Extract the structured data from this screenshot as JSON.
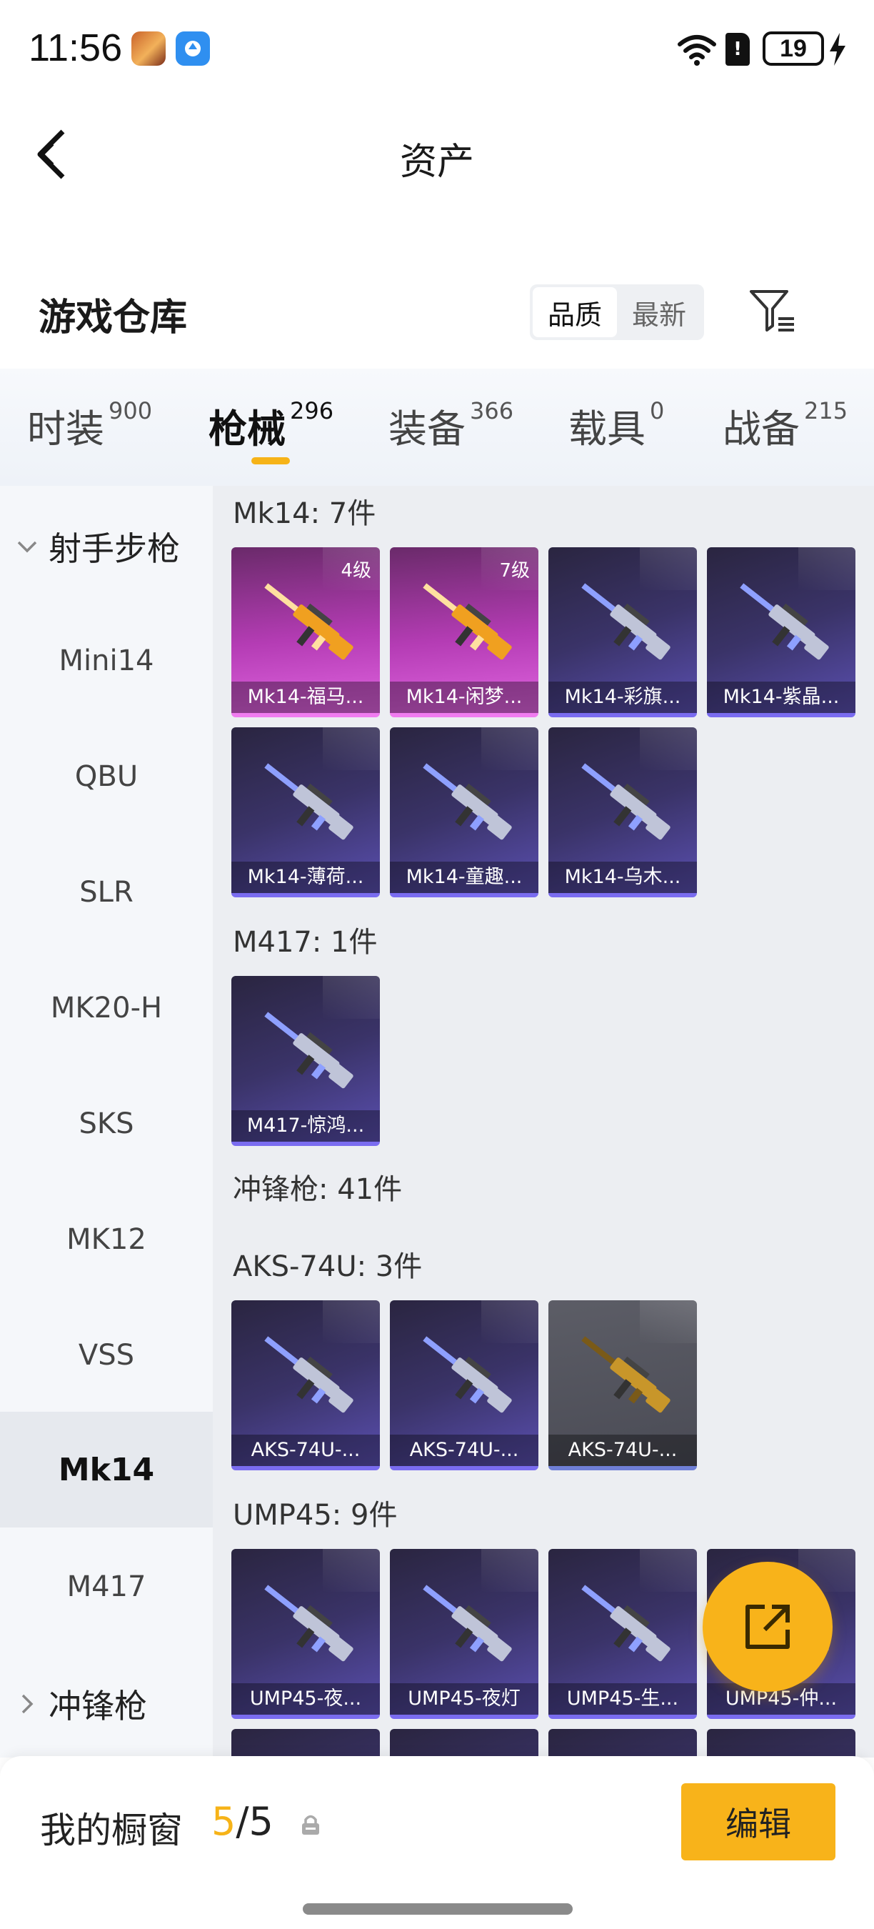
{
  "status_bar": {
    "time": "11:56",
    "battery": "19"
  },
  "header": {
    "title": "资产"
  },
  "warehouse": {
    "title": "游戏仓库",
    "sort_options": [
      "品质",
      "最新"
    ],
    "active_sort": "品质"
  },
  "tabs": [
    {
      "label": "时装",
      "count": "900"
    },
    {
      "label": "枪械",
      "count": "296"
    },
    {
      "label": "装备",
      "count": "366"
    },
    {
      "label": "载具",
      "count": "0"
    },
    {
      "label": "战备",
      "count": "215"
    }
  ],
  "active_tab": "枪械",
  "sidebar": {
    "group_expanded": "射手步枪",
    "items": [
      "Mini14",
      "QBU",
      "SLR",
      "MK20-H",
      "SKS",
      "MK12",
      "VSS",
      "Mk14",
      "M417"
    ],
    "active_item": "Mk14",
    "group_collapsed": "冲锋枪"
  },
  "content": {
    "groups": [
      {
        "label": "Mk14: 7件"
      },
      {
        "label": "M417: 1件"
      },
      {
        "label": "冲锋枪: 41件"
      },
      {
        "label": "AKS-74U: 3件"
      },
      {
        "label": "UMP45: 9件"
      }
    ],
    "mk14_cards": [
      {
        "name": "Mk14-福马...",
        "level": "4级",
        "rarity": "pink"
      },
      {
        "name": "Mk14-闲梦...",
        "level": "7级",
        "rarity": "pink"
      },
      {
        "name": "Mk14-彩旗...",
        "rarity": "purple"
      },
      {
        "name": "Mk14-紫晶...",
        "rarity": "purple"
      },
      {
        "name": "Mk14-薄荷...",
        "rarity": "purple"
      },
      {
        "name": "Mk14-童趣...",
        "rarity": "purple"
      },
      {
        "name": "Mk14-乌木...",
        "rarity": "purple"
      }
    ],
    "m417_cards": [
      {
        "name": "M417-惊鸿...",
        "rarity": "purple"
      }
    ],
    "aks_cards": [
      {
        "name": "AKS-74U-...",
        "rarity": "purple"
      },
      {
        "name": "AKS-74U-...",
        "rarity": "purple"
      },
      {
        "name": "AKS-74U-...",
        "rarity": "grey"
      }
    ],
    "ump_cards": [
      {
        "name": "UMP45-夜...",
        "rarity": "purple"
      },
      {
        "name": "UMP45-夜灯",
        "rarity": "purple"
      },
      {
        "name": "UMP45-生...",
        "rarity": "purple"
      },
      {
        "name": "UMP45-仲...",
        "rarity": "purple"
      }
    ]
  },
  "bottom": {
    "showcase_label": "我的橱窗",
    "showcase_current": "5",
    "showcase_total": "/5",
    "edit_label": "编辑"
  },
  "colors": {
    "accent": "#f8b31a",
    "pink_rarity": "#e064e0",
    "purple_rarity": "#7a6cf0"
  }
}
